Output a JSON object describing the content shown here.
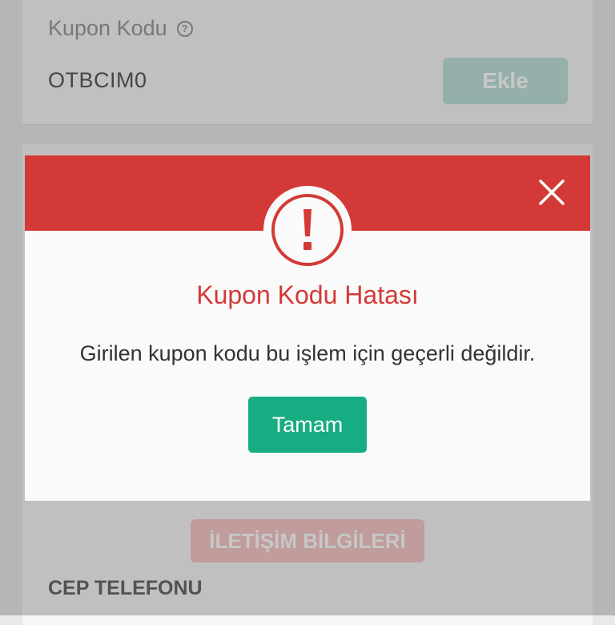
{
  "background": {
    "coupon": {
      "label": "Kupon Kodu",
      "info_icon": "info-icon",
      "value": "OTBCIM0",
      "add_label": "Ekle"
    },
    "contact": {
      "tab_label": "İLETİŞİM BİLGİLERİ",
      "phone_label": "CEP TELEFONU"
    }
  },
  "modal": {
    "title": "Kupon Kodu Hatası",
    "message": "Girilen kupon kodu bu işlem için geçerli değildir.",
    "ok_label": "Tamam",
    "close_icon": "close-icon",
    "alert_icon": "exclamation-icon",
    "colors": {
      "header": "#d33a37",
      "title": "#d33a37",
      "ok_button": "#17ac82"
    }
  }
}
